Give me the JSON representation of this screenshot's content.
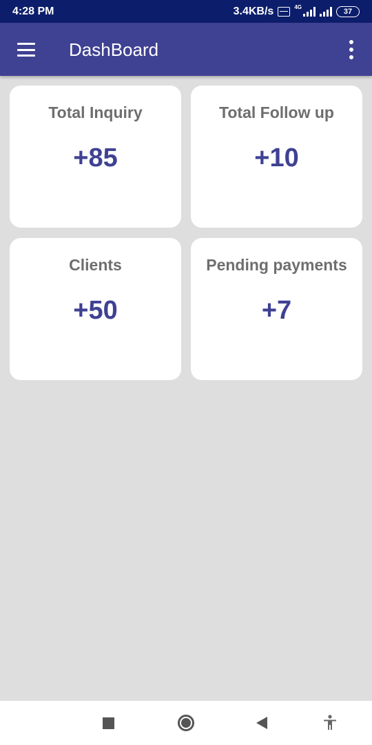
{
  "status_bar": {
    "time": "4:28 PM",
    "net_speed": "3.4KB/s",
    "network_type": "4G",
    "battery": "37",
    "icons": [
      "volte-icon",
      "signal-icon",
      "signal-icon",
      "battery-icon"
    ]
  },
  "app_bar": {
    "title": "DashBoard",
    "menu_icon": "hamburger-menu-icon",
    "overflow_icon": "more-vert-icon",
    "background": "#3f4193"
  },
  "cards": [
    {
      "label": "Total Inquiry",
      "value": "+85"
    },
    {
      "label": "Total Follow up",
      "value": "+10"
    },
    {
      "label": "Clients",
      "value": "+50"
    },
    {
      "label": "Pending payments",
      "value": "+7"
    }
  ],
  "nav_bar": {
    "icons": [
      "recents-square-icon",
      "home-circle-icon",
      "back-triangle-icon",
      "accessibility-icon"
    ]
  },
  "colors": {
    "accent": "#3f4193",
    "status_bar": "#0c1d6b",
    "background": "#dedede",
    "label_text": "#6e6e6e"
  }
}
